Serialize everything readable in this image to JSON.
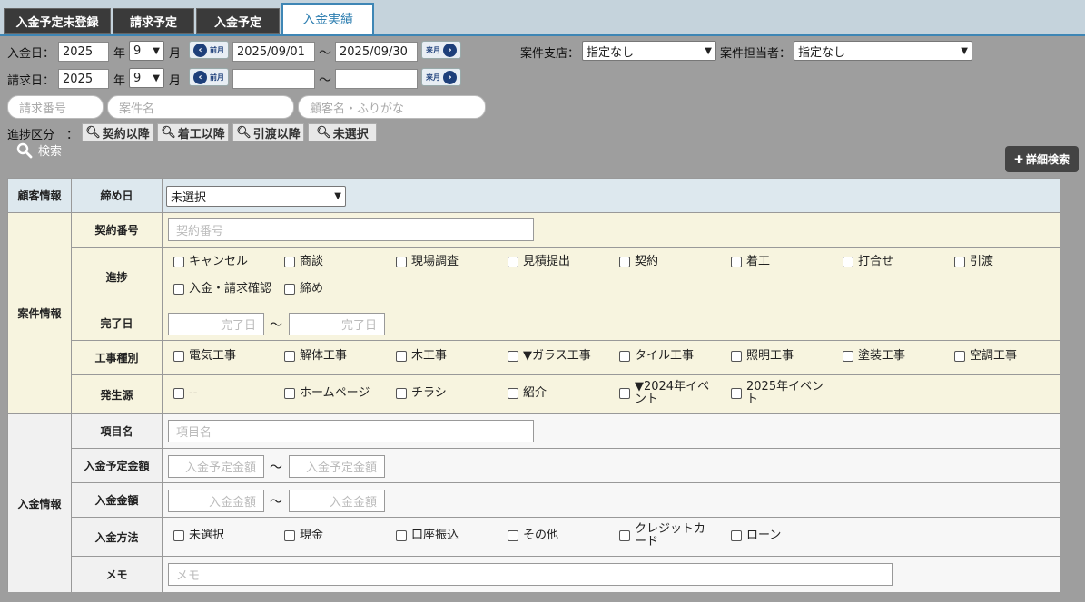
{
  "tabs": [
    "入金予定未登録",
    "請求予定",
    "入金予定",
    "入金実績"
  ],
  "search": {
    "deposit_label": "入金日：",
    "billing_label": "請求日：",
    "year_value": "2025",
    "year_unit": "年",
    "month_value": "9",
    "month_unit": "月",
    "prev_month": "前月",
    "next_month": "来月",
    "deposit_from": "2025/09/01",
    "deposit_to": "2025/09/30",
    "tilde": "～",
    "branch_label": "案件支店：",
    "branch_value": "指定なし",
    "staff_label": "案件担当者：",
    "staff_value": "指定なし",
    "billing_no_placeholder": "請求番号",
    "project_name_placeholder": "案件名",
    "customer_placeholder": "顧客名・ふりがな",
    "progress_label": "進捗区分　：",
    "progress_buttons": [
      "契約以降",
      "着工以降",
      "引渡以降",
      "未選択"
    ],
    "search_label": "検索",
    "detail_label": "詳細検索"
  },
  "table": {
    "sections": {
      "customer": "顧客情報",
      "project": "案件情報",
      "payment": "入金情報"
    },
    "rows": {
      "closing": "締め日",
      "contract": "契約番号",
      "progress": "進捗",
      "complete": "完了日",
      "work": "工事種別",
      "source": "発生源",
      "item": "項目名",
      "planned_amount": "入金予定金額",
      "amount": "入金金額",
      "method": "入金方法",
      "memo": "メモ"
    },
    "closing_value": "未選択",
    "contract_placeholder": "契約番号",
    "complete_placeholder": "完了日",
    "item_placeholder": "項目名",
    "planned_placeholder": "入金予定金額",
    "amount_placeholder": "入金金額",
    "memo_placeholder": "メモ",
    "progress_options": [
      "キャンセル",
      "商談",
      "現場調査",
      "見積提出",
      "契約",
      "着工",
      "打合せ",
      "引渡",
      "入金・請求確認",
      "締め"
    ],
    "work_options": [
      "電気工事",
      "解体工事",
      "木工事",
      "▼ガラス工事",
      "タイル工事",
      "照明工事",
      "塗装工事",
      "空調工事"
    ],
    "source_options": [
      "--",
      "ホームページ",
      "チラシ",
      "紹介",
      "▼2024年イベント",
      "2025年イベント"
    ],
    "method_options": [
      "未選択",
      "現金",
      "口座振込",
      "その他",
      "クレジットカード",
      "ローン"
    ]
  }
}
